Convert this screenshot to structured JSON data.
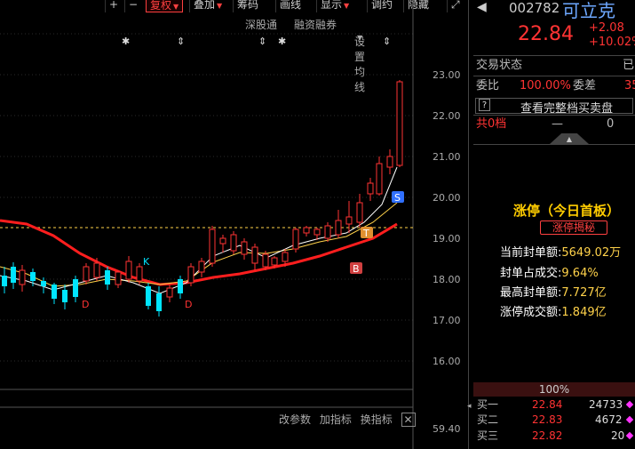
{
  "toolbar": {
    "plus": "+",
    "minus": "−",
    "fuquan": "复权",
    "diejia": "叠加",
    "choumao": "筹码",
    "huaxian": "画线",
    "xianshi": "显示",
    "tiaoyue": "调约",
    "yincang": "隐藏"
  },
  "subbar": {
    "shengutong": "深股通",
    "rongzi": "融资融券",
    "setma": "设置均线"
  },
  "axis": {
    "ticks": [
      "23.00",
      "22.00",
      "21.00",
      "20.00",
      "19.00",
      "18.00",
      "17.00",
      "16.00"
    ],
    "lower_tick": "59.40"
  },
  "markers": {
    "K": "K",
    "D1": "D",
    "D2": "D",
    "S": "S",
    "T": "T",
    "B": "B"
  },
  "indicator_bar": {
    "gaicanshu": "改参数",
    "jiazhibiao": "加指标",
    "huanzhibiao": "换指标"
  },
  "quote": {
    "code": "002782",
    "name": "可立克",
    "price": "22.84",
    "change": "+2.08",
    "change_pct": "+10.02%"
  },
  "status": {
    "label": "交易状态",
    "value": "已",
    "weibi_label": "委比",
    "weibi_value": "100.00%",
    "weicha_label": "委差",
    "weicha_value": "35",
    "view_full": "查看完整档买卖盘",
    "level_label": "共0档",
    "level_dash": "—",
    "level_value": "0"
  },
  "limit_up": {
    "title": "涨停（今日首板）",
    "tag": "涨停揭秘",
    "rows": [
      {
        "label": "当前封单额:",
        "value": "5649.02万"
      },
      {
        "label": "封单占成交:",
        "value": "9.64%"
      },
      {
        "label": "最高封单额:",
        "value": "7.727亿"
      },
      {
        "label": "涨停成交额:",
        "value": "1.849亿"
      }
    ]
  },
  "orderbook": {
    "pct": "100%",
    "rows": [
      {
        "label": "买一",
        "price": "22.84",
        "vol": "24733"
      },
      {
        "label": "买二",
        "price": "22.83",
        "vol": "4672"
      },
      {
        "label": "买三",
        "price": "22.82",
        "vol": "20"
      }
    ]
  },
  "colors": {
    "up": "#ff3333",
    "down": "#00e5ff",
    "ma_red": "#ff1e1e",
    "ma_yellow": "#ffd24a",
    "ma_white": "#ffffff"
  }
}
